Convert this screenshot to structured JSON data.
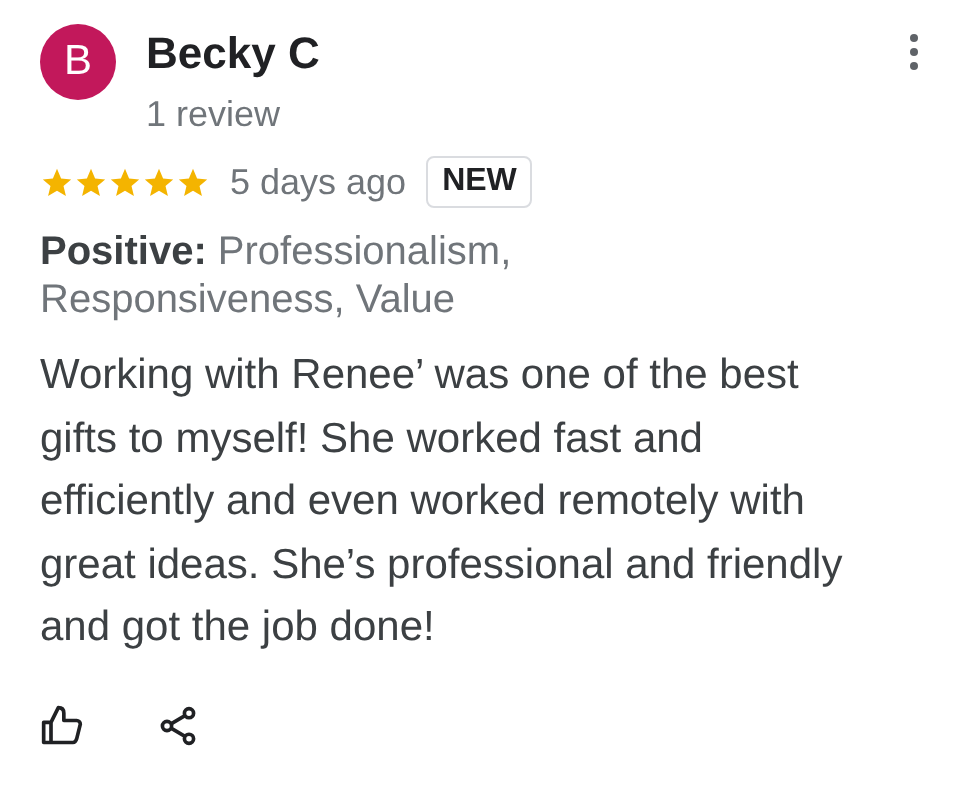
{
  "review": {
    "avatar_letter": "B",
    "author": "Becky C",
    "author_meta": "1 review",
    "stars": 5,
    "time": "5 days ago",
    "badge": "NEW",
    "highlights": "**Positive:** Professionalism, Responsiveness, Value",
    "text": "Working with Renee’ was one of the best gifts to myself! She worked fast and efficiently and even worked remotely with great ideas. She’s professional and friendly and got the job done!"
  }
}
